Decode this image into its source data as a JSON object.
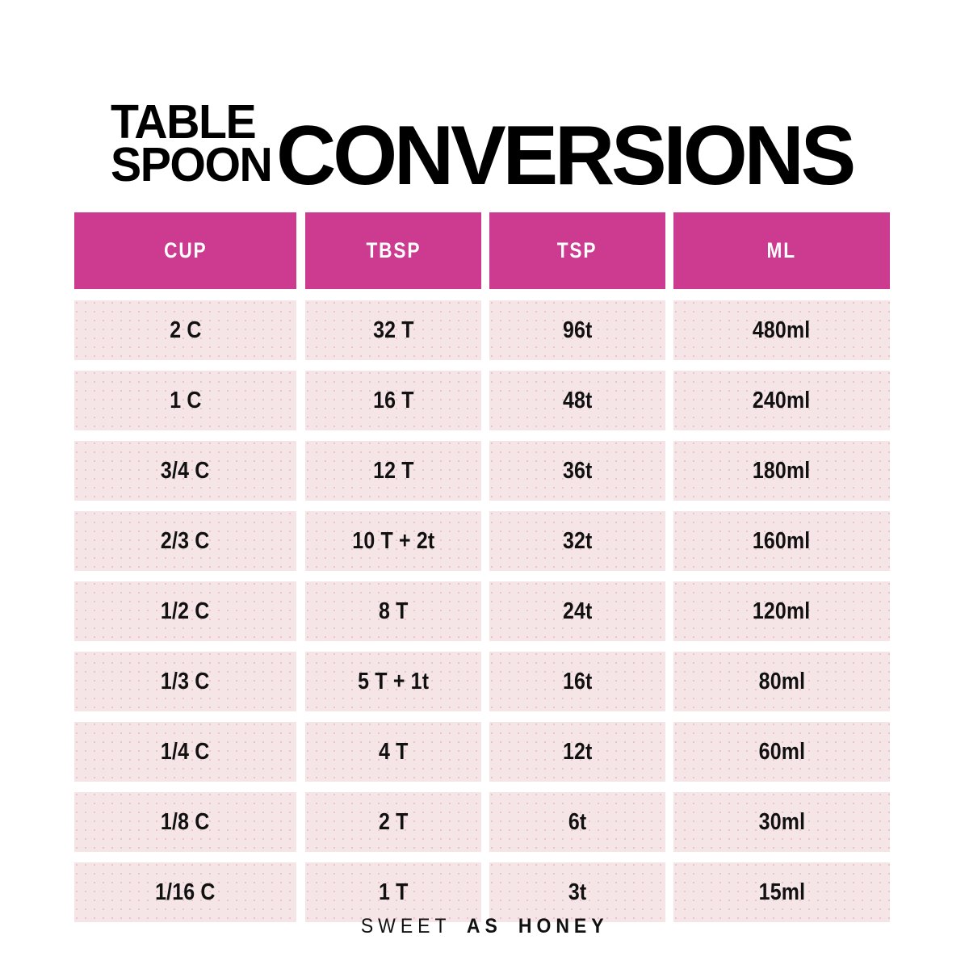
{
  "title": {
    "small_line_1": "TABLE",
    "small_line_2": "SPOON",
    "large": "CONVERSIONS"
  },
  "colors": {
    "header_pink": "#CC3B8F",
    "cell_pink": "#F6E5E7",
    "text_dark": "#111111",
    "page_background": "#FFFFFF"
  },
  "table": {
    "columns": [
      "CUP",
      "TBSP",
      "TSP",
      "ML"
    ],
    "rows": [
      {
        "cup": "2 C",
        "tbsp": "32 T",
        "tsp": "96t",
        "ml": "480ml"
      },
      {
        "cup": "1 C",
        "tbsp": "16 T",
        "tsp": "48t",
        "ml": "240ml"
      },
      {
        "cup": "3/4 C",
        "tbsp": "12 T",
        "tsp": "36t",
        "ml": "180ml"
      },
      {
        "cup": "2/3 C",
        "tbsp": "10 T + 2t",
        "tsp": "32t",
        "ml": "160ml"
      },
      {
        "cup": "1/2 C",
        "tbsp": "8 T",
        "tsp": "24t",
        "ml": "120ml"
      },
      {
        "cup": "1/3 C",
        "tbsp": "5 T + 1t",
        "tsp": "16t",
        "ml": "80ml"
      },
      {
        "cup": "1/4 C",
        "tbsp": "4 T",
        "tsp": "12t",
        "ml": "60ml"
      },
      {
        "cup": "1/8 C",
        "tbsp": "2 T",
        "tsp": "6t",
        "ml": "30ml"
      },
      {
        "cup": "1/16 C",
        "tbsp": "1 T",
        "tsp": "3t",
        "ml": "15ml"
      }
    ]
  },
  "footer": {
    "word_1": "SWEET",
    "word_2": "AS",
    "word_3": "HONEY"
  }
}
